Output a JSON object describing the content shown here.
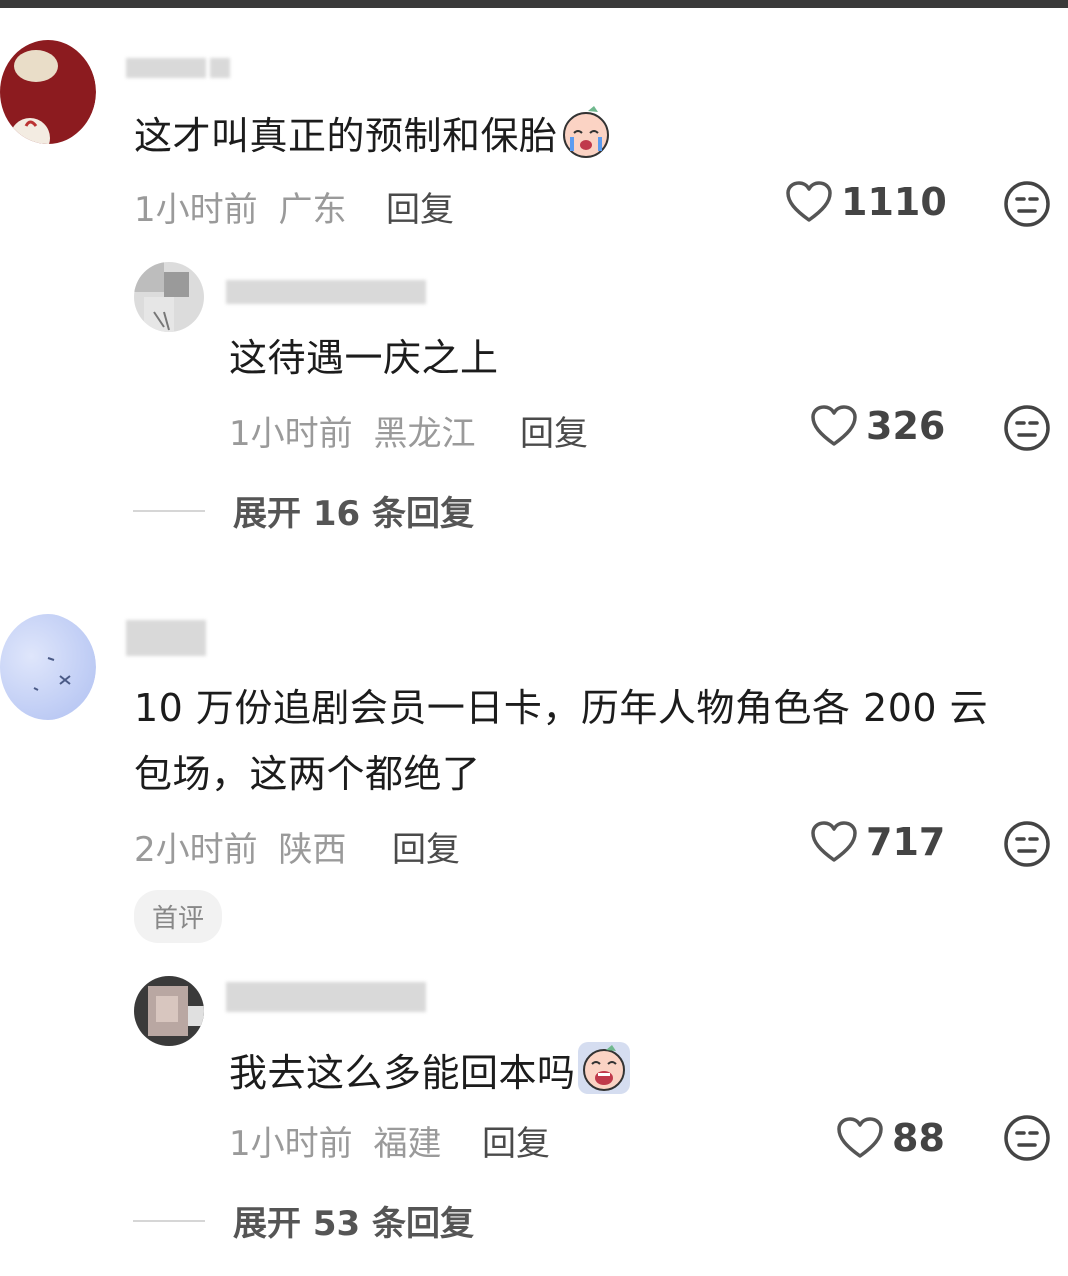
{
  "comments": [
    {
      "text": "这才叫真正的预制和保胎",
      "time": "1小时前",
      "location": "广东",
      "reply_label": "回复",
      "likes": "1110",
      "replies": [
        {
          "text": "这待遇一庆之上",
          "time": "1小时前",
          "location": "黑龙江",
          "reply_label": "回复",
          "likes": "326"
        }
      ],
      "expand_label": "展开 16 条回复"
    },
    {
      "text_line1": "10 万份追剧会员一日卡，历年人物角色各 200 云",
      "text_line2": "包场，这两个都绝了",
      "time": "2小时前",
      "location": "陕西",
      "reply_label": "回复",
      "likes": "717",
      "badge": "首评",
      "replies": [
        {
          "text": "我去这么多能回本吗",
          "time": "1小时前",
          "location": "福建",
          "reply_label": "回复",
          "likes": "88"
        }
      ],
      "expand_label": "展开 53 条回复"
    }
  ],
  "icons": {
    "like": "heart-outline-icon",
    "dislike": "meh-face-icon",
    "emoji1": "crying-emoji",
    "emoji2": "screaming-emoji"
  }
}
